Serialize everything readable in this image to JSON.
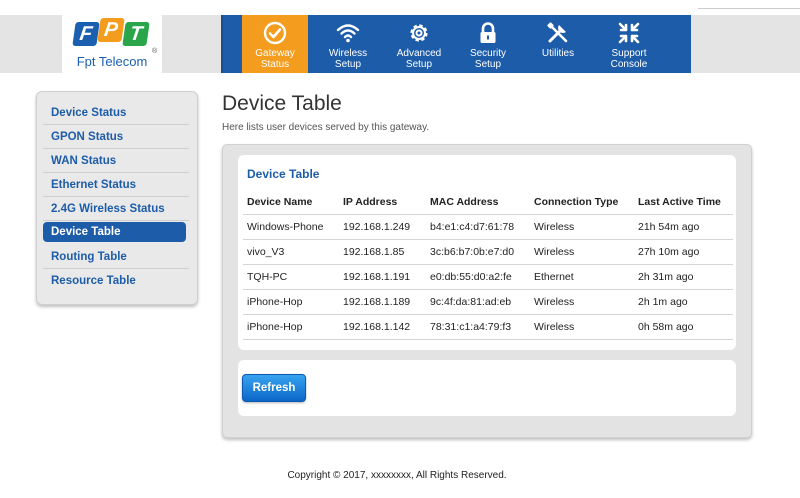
{
  "brand": {
    "logo_letters": [
      "F",
      "P",
      "T"
    ],
    "logo_reg": "®",
    "logo_text": "Fpt Telecom",
    "colors": {
      "blue": "#1d5ca8",
      "orange": "#f39c1d",
      "green": "#2aa54a"
    }
  },
  "nav": {
    "items": [
      {
        "label": "Gateway\nStatus",
        "icon": "check-circle-icon",
        "active": true
      },
      {
        "label": "Wireless\nSetup",
        "icon": "wifi-icon",
        "active": false
      },
      {
        "label": "Advanced\nSetup",
        "icon": "gear-icon",
        "active": false
      },
      {
        "label": "Security\nSetup",
        "icon": "lock-icon",
        "active": false
      },
      {
        "label": "Utilities",
        "icon": "tools-icon",
        "active": false
      },
      {
        "label": "Support\nConsole",
        "icon": "compress-arrows-icon",
        "active": false
      }
    ]
  },
  "sidebar": {
    "items": [
      {
        "label": "Device Status",
        "active": false
      },
      {
        "label": "GPON Status",
        "active": false
      },
      {
        "label": "WAN Status",
        "active": false
      },
      {
        "label": "Ethernet Status",
        "active": false
      },
      {
        "label": "2.4G Wireless Status",
        "active": false
      },
      {
        "label": "Device Table",
        "active": true
      },
      {
        "label": "Routing Table",
        "active": false
      },
      {
        "label": "Resource Table",
        "active": false
      }
    ]
  },
  "main": {
    "title": "Device Table",
    "subtitle": "Here lists user devices served by this gateway.",
    "card_title": "Device Table",
    "columns": [
      "Device Name",
      "IP Address",
      "MAC Address",
      "Connection Type",
      "Last Active Time"
    ],
    "rows": [
      [
        "Windows-Phone",
        "192.168.1.249",
        "b4:e1:c4:d7:61:78",
        "Wireless",
        "21h 54m ago"
      ],
      [
        "vivo_V3",
        "192.168.1.85",
        "3c:b6:b7:0b:e7:d0",
        "Wireless",
        "27h 10m ago"
      ],
      [
        "TQH-PC",
        "192.168.1.191",
        "e0:db:55:d0:a2:fe",
        "Ethernet",
        "2h 31m ago"
      ],
      [
        "iPhone-Hop",
        "192.168.1.189",
        "9c:4f:da:81:ad:eb",
        "Wireless",
        "2h 1m ago"
      ],
      [
        "iPhone-Hop",
        "192.168.1.142",
        "78:31:c1:a4:79:f3",
        "Wireless",
        "0h 58m ago"
      ]
    ],
    "refresh_label": "Refresh"
  },
  "footer": {
    "text": "Copyright © 2017, xxxxxxxx, All Rights Reserved."
  }
}
